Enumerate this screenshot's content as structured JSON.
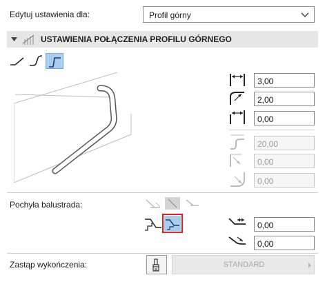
{
  "top": {
    "edit_label": "Edytuj ustawienia dla:",
    "selected": "Profil górny"
  },
  "section": {
    "title": "USTAWIENIA POŁĄCZENIA PROFILU GÓRNEGO"
  },
  "connection": {
    "fields": [
      "3,00",
      "2,00",
      "0,00"
    ],
    "disabled_fields": [
      "20,00",
      "0,00",
      "0,00"
    ]
  },
  "slope": {
    "label": "Pochyła balustrada:",
    "fields": [
      "0,00",
      "0,00"
    ]
  },
  "override": {
    "label": "Zastąp wykończenia:",
    "value": "STANDARD"
  }
}
